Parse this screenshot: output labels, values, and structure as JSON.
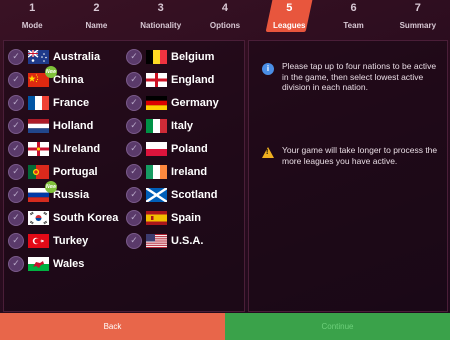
{
  "steps": [
    {
      "num": "1",
      "label": "Mode"
    },
    {
      "num": "2",
      "label": "Name"
    },
    {
      "num": "3",
      "label": "Nationality"
    },
    {
      "num": "4",
      "label": "Options"
    },
    {
      "num": "5",
      "label": "Leagues"
    },
    {
      "num": "6",
      "label": "Team"
    },
    {
      "num": "7",
      "label": "Summary"
    }
  ],
  "active_step": 4,
  "nations_col1": [
    "Australia",
    "China",
    "France",
    "Holland",
    "N.Ireland",
    "Portugal",
    "Russia",
    "South Korea",
    "Turkey",
    "Wales"
  ],
  "nations_col2": [
    "Belgium",
    "England",
    "Germany",
    "Italy",
    "Poland",
    "Ireland",
    "Scotland",
    "Spain",
    "U.S.A."
  ],
  "new_badge": "New",
  "info": {
    "tip": "Please tap up to four nations to be active in the game, then select lowest active division in each nation.",
    "warning": "Your game will take longer to process the more leagues you have active."
  },
  "buttons": {
    "back": "Back",
    "next": "Continue"
  },
  "colors": {
    "accent": "#e8563d",
    "back": "#e8664a",
    "next": "#3aa24a",
    "check": "#5a3a6a"
  }
}
